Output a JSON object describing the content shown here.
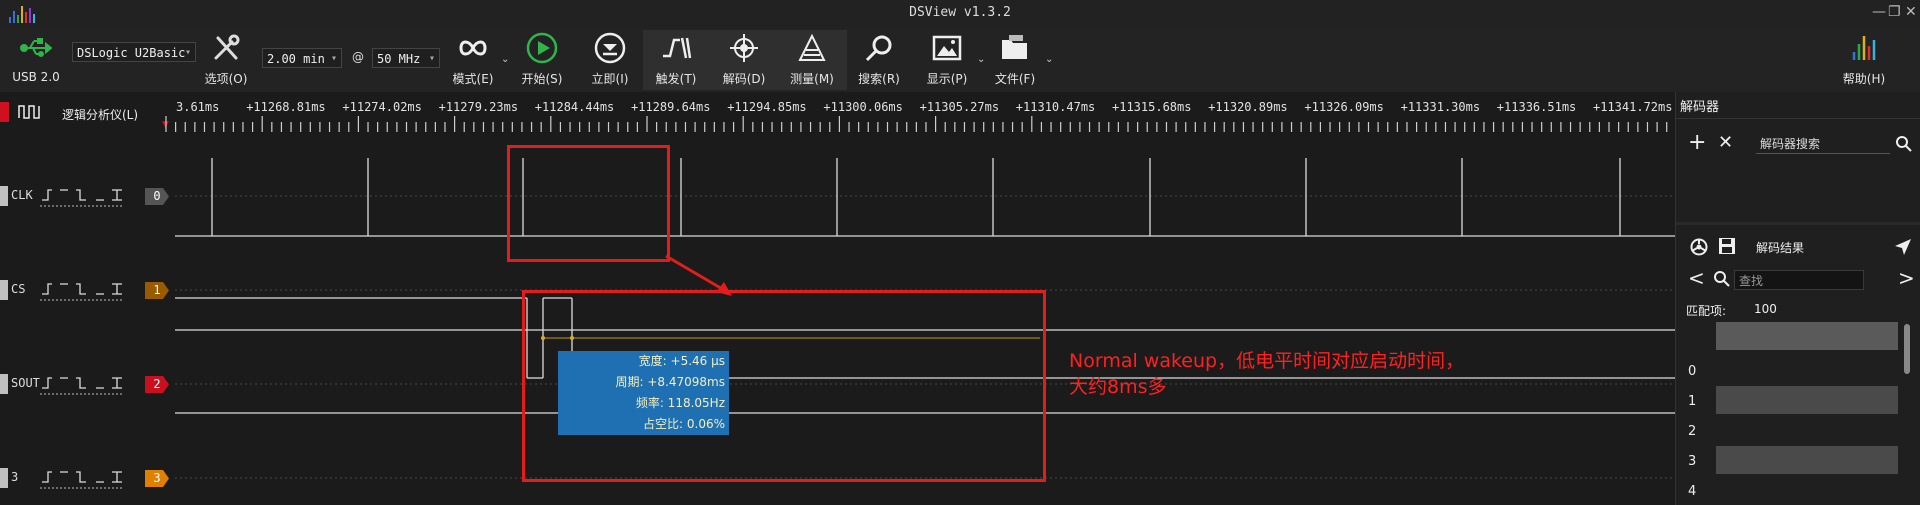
{
  "window": {
    "title": "DSView v1.3.2"
  },
  "toolbar": {
    "usb_label": "USB 2.0",
    "device": "DSLogic U2Basic",
    "options_label": "选项(O)",
    "duration": "2.00 min",
    "at": "@",
    "samplerate": "50 MHz",
    "mode_label": "模式(E)",
    "start_label": "开始(S)",
    "instant_label": "立即(I)",
    "trigger_label": "触发(T)",
    "decode_label": "解码(D)",
    "measure_label": "测量(M)",
    "search_label": "搜索(R)",
    "display_label": "显示(P)",
    "file_label": "文件(F)",
    "help_label": "帮助(H)"
  },
  "ruler": {
    "title": "逻辑分析仪(L)",
    "ticks": [
      "3.61ms",
      "+11268.81ms",
      "+11274.02ms",
      "+11279.23ms",
      "+11284.44ms",
      "+11289.64ms",
      "+11294.85ms",
      "+11300.06ms",
      "+11305.27ms",
      "+11310.47ms",
      "+11315.68ms",
      "+11320.89ms",
      "+11326.09ms",
      "+11331.30ms",
      "+11336.51ms",
      "+11341.72ms"
    ]
  },
  "channels": [
    {
      "name": "CLK",
      "index": "0",
      "color": "#555555"
    },
    {
      "name": "CS",
      "index": "1",
      "color": "#9a5a00"
    },
    {
      "name": "SOUT",
      "index": "2",
      "color": "#c8101e"
    },
    {
      "name": "3",
      "index": "3",
      "color": "#e08000"
    }
  ],
  "measurement": {
    "width": "宽度: +5.46 μs",
    "period": "周期: +8.47098ms",
    "frequency": "频率: 118.05Hz",
    "duty": "占空比: 0.06%"
  },
  "annotation": {
    "line1": "Normal wakeup，低电平时间对应启动时间，",
    "line2": "大约8ms多"
  },
  "decoder_panel": {
    "title": "解码器",
    "search_placeholder": "解码器搜索",
    "results_label": "解码结果",
    "find_placeholder": "查找",
    "match_label": "匹配项:",
    "match_count": "100",
    "rows": [
      "0",
      "1",
      "2",
      "3",
      "4"
    ]
  }
}
